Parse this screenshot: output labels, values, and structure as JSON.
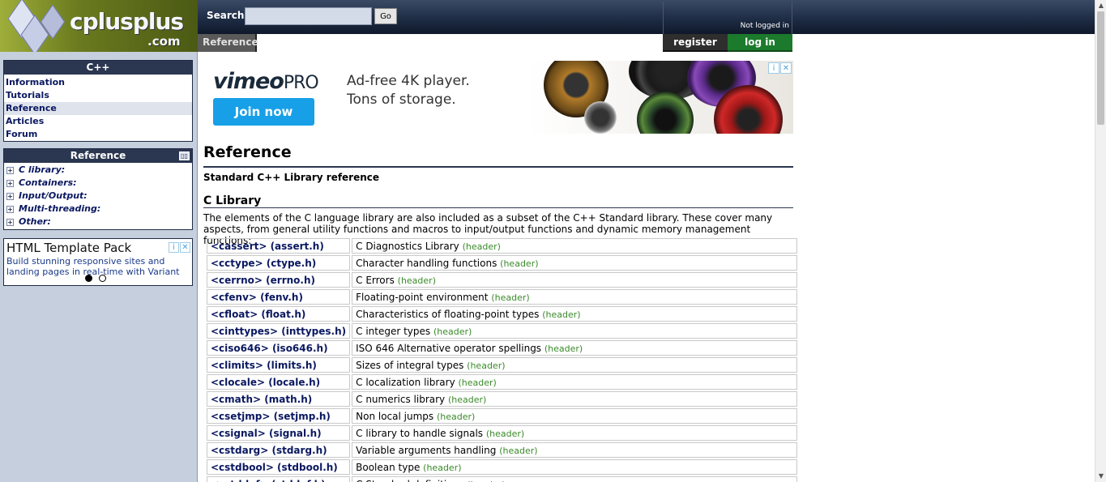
{
  "logo": {
    "brand": "cplusplus",
    "domain": ".com"
  },
  "search": {
    "label": "Search:",
    "placeholder": "",
    "value": "",
    "go_label": "Go"
  },
  "header": {
    "tab_reference": "Reference",
    "not_logged_in": "Not logged in",
    "register": "register",
    "login": "log in"
  },
  "sidebar": {
    "cpp_title": "C++",
    "cpp_items": [
      "Information",
      "Tutorials",
      "Reference",
      "Articles",
      "Forum"
    ],
    "active_item": "Reference",
    "reference_title": "Reference",
    "reference_items": [
      "C library:",
      "Containers:",
      "Input/Output:",
      "Multi-threading:",
      "Other:"
    ],
    "ad": {
      "title": "HTML Template Pack",
      "text": "Build stunning responsive sites and landing pages in real-time with Variant"
    }
  },
  "banner": {
    "brand": "vimeo",
    "brand_suffix": "PRO",
    "tagline1": "Ad-free 4K player.",
    "tagline2": "Tons of storage.",
    "cta": "Join now"
  },
  "main": {
    "title": "Reference",
    "subtitle": "Standard C++ Library reference",
    "section_title": "C Library",
    "intro": "The elements of the C language library are also included as a subset of the C++ Standard library. These cover many aspects, from general utility functions and macros to input/output functions and dynamic memory management functions:",
    "header_tag": "(header)",
    "rows": [
      {
        "name": "<cassert> (assert.h)",
        "desc": "C Diagnostics Library"
      },
      {
        "name": "<cctype> (ctype.h)",
        "desc": "Character handling functions"
      },
      {
        "name": "<cerrno> (errno.h)",
        "desc": "C Errors"
      },
      {
        "name": "<cfenv> (fenv.h)",
        "desc": "Floating-point environment"
      },
      {
        "name": "<cfloat> (float.h)",
        "desc": "Characteristics of floating-point types"
      },
      {
        "name": "<cinttypes> (inttypes.h)",
        "desc": "C integer types"
      },
      {
        "name": "<ciso646> (iso646.h)",
        "desc": "ISO 646 Alternative operator spellings"
      },
      {
        "name": "<climits> (limits.h)",
        "desc": "Sizes of integral types"
      },
      {
        "name": "<clocale> (locale.h)",
        "desc": "C localization library"
      },
      {
        "name": "<cmath> (math.h)",
        "desc": "C numerics library"
      },
      {
        "name": "<csetjmp> (setjmp.h)",
        "desc": "Non local jumps"
      },
      {
        "name": "<csignal> (signal.h)",
        "desc": "C library to handle signals"
      },
      {
        "name": "<cstdarg> (stdarg.h)",
        "desc": "Variable arguments handling"
      },
      {
        "name": "<cstdbool> (stdbool.h)",
        "desc": "Boolean type"
      },
      {
        "name": "<cstddef> (stddef.h)",
        "desc": "C Standard definitions"
      }
    ]
  },
  "colors": {
    "nav_dark": "#2b3650",
    "link": "#0a1860",
    "header_tag": "#3a8a2a",
    "login_green": "#1b7a2b",
    "sidebar_bg": "#c6cfdd"
  }
}
